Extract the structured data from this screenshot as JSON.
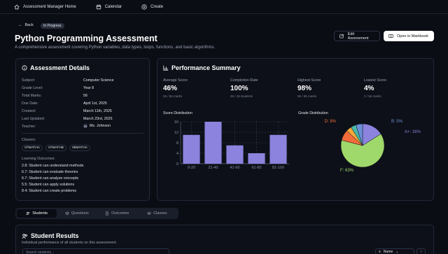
{
  "nav": {
    "home": "Assessment Manager Home",
    "calendar": "Calendar",
    "create": "Create"
  },
  "header": {
    "back": "Back",
    "status": "In Progress",
    "title": "Python Programming Assessment",
    "subtitle": "A comprehensive assessment covering Python variables, data types, loops, functions, and basic algorithms.",
    "edit_button": "Edit Assessment",
    "open_button": "Open in Markbook"
  },
  "details": {
    "title": "Assessment Details",
    "rows": [
      {
        "label": "Subject:",
        "value": "Computer Science"
      },
      {
        "label": "Grade Level:",
        "value": "Year 8"
      },
      {
        "label": "Total Marks:",
        "value": "56"
      },
      {
        "label": "Due Date:",
        "value": "April 1st, 2025"
      },
      {
        "label": "Created:",
        "value": "March 11th, 2025"
      },
      {
        "label": "Last Updated:",
        "value": "March 23rd, 2025"
      },
      {
        "label": "Teacher:",
        "value": "Ms. Johnson",
        "avatar": "M"
      }
    ],
    "classes_label": "Classes:",
    "classes": [
      "07MATHA",
      "07MATHB",
      "08MATHA"
    ],
    "outcomes_label": "Learning Outcomes:",
    "outcomes": [
      "2.8: Student can understand methods",
      "6.7: Student can evaluate theories",
      "6.7: Student can analyze concepts",
      "5.5: Student can apply solutions",
      "8.4: Student can create problems"
    ]
  },
  "performance": {
    "title": "Performance Summary",
    "stats": [
      {
        "label": "Average Score",
        "value": "46%",
        "sub": "26 / 56 marks"
      },
      {
        "label": "Completion Rate",
        "value": "100%",
        "sub": "49 / 49 students"
      },
      {
        "label": "Highest Score",
        "value": "98%",
        "sub": "55 / 56 marks"
      },
      {
        "label": "Lowest Score",
        "value": "4%",
        "sub": "2 / 56 marks"
      }
    ]
  },
  "chart_data": [
    {
      "type": "bar",
      "title": "Score Distribution",
      "categories": [
        "0-20",
        "21-40",
        "41-60",
        "61-80",
        "81-100"
      ],
      "values": [
        11,
        16,
        7,
        4,
        11
      ],
      "ylim": [
        0,
        16
      ],
      "yticks": [
        0,
        4,
        8,
        12,
        16
      ],
      "grid": true,
      "color": "#8b83dd"
    },
    {
      "type": "pie",
      "title": "Grade Distribution",
      "slices": [
        {
          "label": "A+: 16%",
          "value": 16,
          "color": "#8b83dd"
        },
        {
          "label": "F: 63%",
          "value": 63,
          "color": "#9fd86b"
        },
        {
          "label": "D: 8%",
          "value": 8,
          "color": "#f26b3a"
        },
        {
          "label": "",
          "value": 4,
          "color": "#f2a93b"
        },
        {
          "label": "",
          "value": 4,
          "color": "#49b8a7"
        },
        {
          "label": "B: 5%",
          "value": 5,
          "color": "#6b8fd8"
        }
      ]
    }
  ],
  "tabs": [
    "Students",
    "Questions",
    "Outcomes",
    "Classes"
  ],
  "results": {
    "title": "Student Results",
    "subtitle": "Individual performance of all students on this assessment.",
    "search_placeholder": "Search students...",
    "sort_label": "Name"
  }
}
